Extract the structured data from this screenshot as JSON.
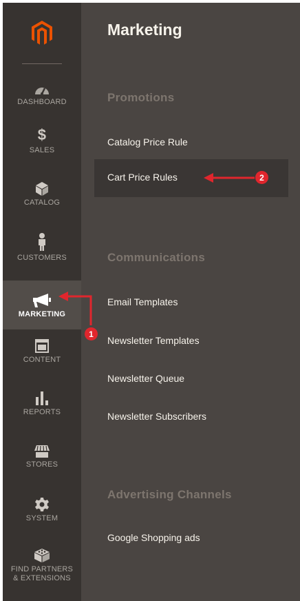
{
  "sidebar": {
    "logo": "magento-logo",
    "items": [
      {
        "label": "DASHBOARD",
        "icon": "speedometer-icon"
      },
      {
        "label": "SALES",
        "icon": "dollar-icon"
      },
      {
        "label": "CATALOG",
        "icon": "box-icon"
      },
      {
        "label": "CUSTOMERS",
        "icon": "person-icon"
      },
      {
        "label": "MARKETING",
        "icon": "megaphone-icon",
        "active": true
      },
      {
        "label": "CONTENT",
        "icon": "layout-icon"
      },
      {
        "label": "REPORTS",
        "icon": "bar-chart-icon"
      },
      {
        "label": "STORES",
        "icon": "storefront-icon"
      },
      {
        "label": "SYSTEM",
        "icon": "gear-icon"
      },
      {
        "label": "FIND PARTNERS",
        "label2": "& EXTENSIONS",
        "icon": "blocks-icon"
      }
    ]
  },
  "panel": {
    "title": "Marketing",
    "sections": [
      {
        "title": "Promotions",
        "links": [
          "Catalog Price Rule",
          "Cart Price Rules"
        ]
      },
      {
        "title": "Communications",
        "links": [
          "Email Templates",
          "Newsletter Templates",
          "Newsletter Queue",
          "Newsletter Subscribers"
        ]
      },
      {
        "title": "Advertising Channels",
        "links": [
          "Google Shopping ads"
        ]
      }
    ]
  },
  "callouts": {
    "first": "1",
    "second": "2"
  },
  "colors": {
    "sidebar": "#373330",
    "panel": "#4a4542",
    "active": "#524d49",
    "callout": "#e0262d",
    "logo": "#eb5202"
  }
}
